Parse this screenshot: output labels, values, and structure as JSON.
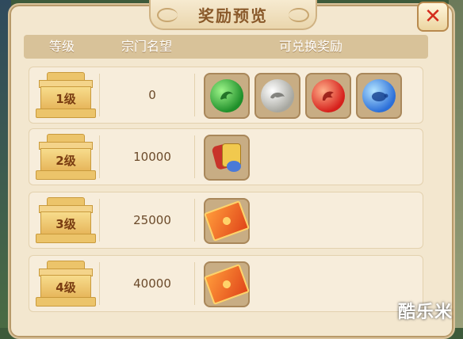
{
  "title": "奖励预览",
  "close_icon": "close-icon",
  "header": {
    "level": "等级",
    "prestige": "宗门名望",
    "rewards": "可兑换奖励"
  },
  "rows": [
    {
      "level": "1级",
      "prestige": "0",
      "rewards": [
        "green-dragon-orb-icon",
        "white-tiger-orb-icon",
        "red-phoenix-orb-icon",
        "blue-tortoise-orb-icon"
      ]
    },
    {
      "level": "2级",
      "prestige": "10000",
      "rewards": [
        "item-bundle-icon"
      ]
    },
    {
      "level": "3级",
      "prestige": "25000",
      "rewards": [
        "golden-ticket-icon"
      ]
    },
    {
      "level": "4级",
      "prestige": "40000",
      "rewards": [
        "golden-ticket-icon"
      ]
    }
  ],
  "watermark": "酷乐米"
}
